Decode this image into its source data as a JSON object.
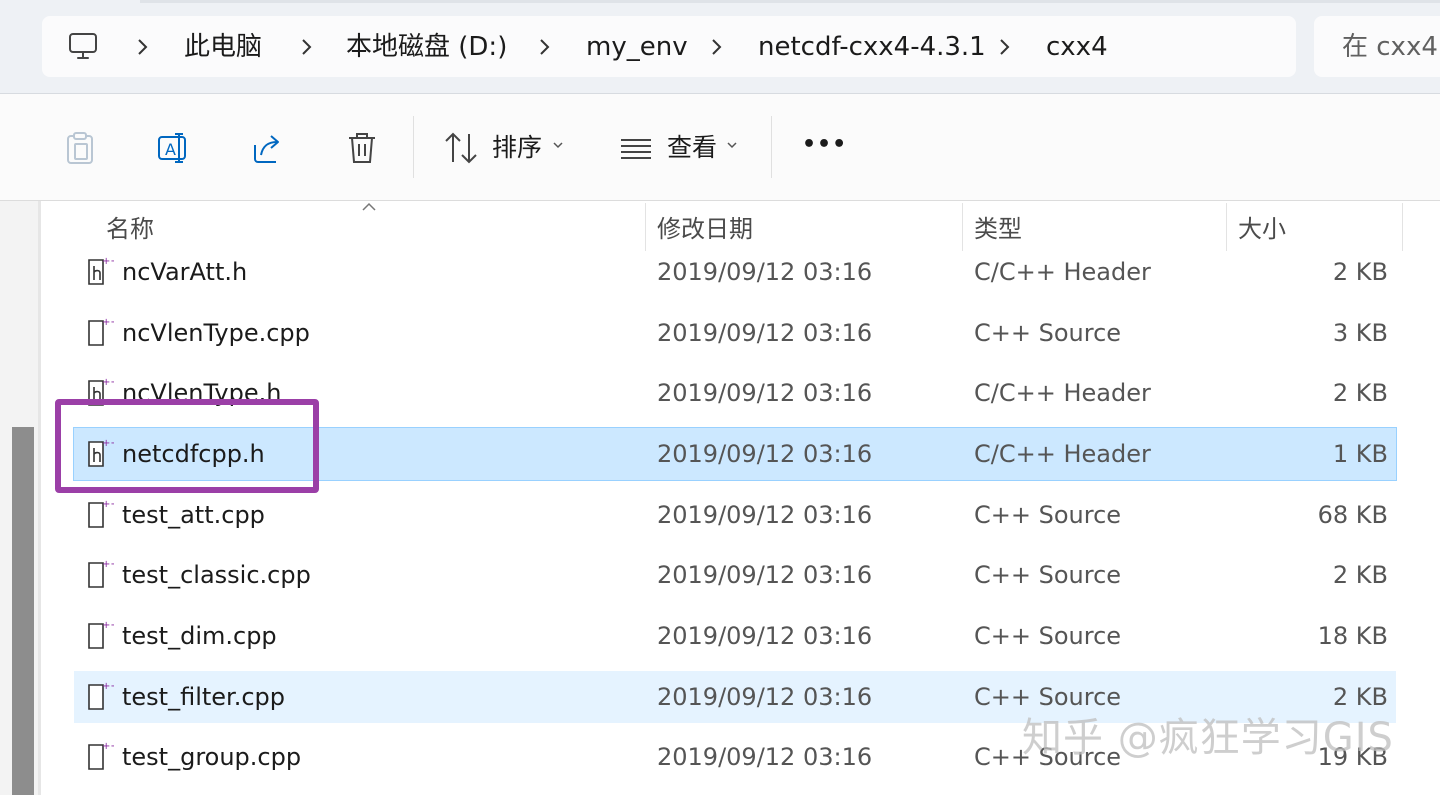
{
  "address_bar": {
    "crumbs": [
      "此电脑",
      "本地磁盘 (D:)",
      "my_env",
      "netcdf-cxx4-4.3.1",
      "cxx4"
    ],
    "search_placeholder": "在 cxx4"
  },
  "toolbar": {
    "sort_label": "排序",
    "view_label": "查看",
    "more_label": "•••"
  },
  "columns": {
    "name": "名称",
    "modified": "修改日期",
    "type": "类型",
    "size": "大小"
  },
  "files": [
    {
      "name": "ncVarAtt.h",
      "modified": "2019/09/12 03:16",
      "type": "C/C++ Header",
      "size": "2 KB",
      "icon": "header-file-icon"
    },
    {
      "name": "ncVlenType.cpp",
      "modified": "2019/09/12 03:16",
      "type": "C++ Source",
      "size": "3 KB",
      "icon": "cpp-file-icon"
    },
    {
      "name": "ncVlenType.h",
      "modified": "2019/09/12 03:16",
      "type": "C/C++ Header",
      "size": "2 KB",
      "icon": "header-file-icon"
    },
    {
      "name": "netcdfcpp.h",
      "modified": "2019/09/12 03:16",
      "type": "C/C++ Header",
      "size": "1 KB",
      "icon": "header-file-icon",
      "selected": true
    },
    {
      "name": "test_att.cpp",
      "modified": "2019/09/12 03:16",
      "type": "C++ Source",
      "size": "68 KB",
      "icon": "cpp-file-icon"
    },
    {
      "name": "test_classic.cpp",
      "modified": "2019/09/12 03:16",
      "type": "C++ Source",
      "size": "2 KB",
      "icon": "cpp-file-icon"
    },
    {
      "name": "test_dim.cpp",
      "modified": "2019/09/12 03:16",
      "type": "C++ Source",
      "size": "18 KB",
      "icon": "cpp-file-icon"
    },
    {
      "name": "test_filter.cpp",
      "modified": "2019/09/12 03:16",
      "type": "C++ Source",
      "size": "2 KB",
      "icon": "cpp-file-icon",
      "hover": true
    },
    {
      "name": "test_group.cpp",
      "modified": "2019/09/12 03:16",
      "type": "C++ Source",
      "size": "19 KB",
      "icon": "cpp-file-icon"
    }
  ],
  "watermark": "知乎 @疯狂学习GIS",
  "colors": {
    "selection": "#cce8ff",
    "hover": "#e5f3ff",
    "highlight_box": "#9b3fa7",
    "accent": "#0067c0"
  }
}
